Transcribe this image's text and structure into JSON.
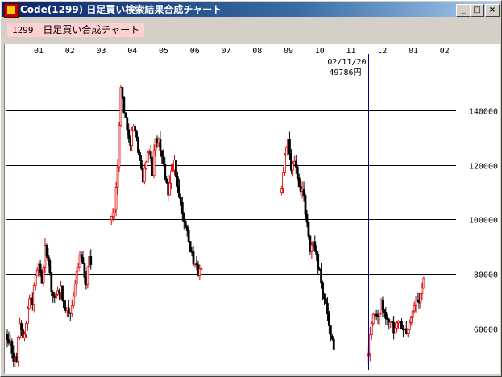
{
  "window": {
    "title": "Code(1299)  日足買い検索結果合成チャート",
    "buttons": {
      "minimize": "_",
      "maximize": "□",
      "close": "×"
    }
  },
  "header": {
    "code": "1299",
    "label": "日足買い合成チャート"
  },
  "cursor": {
    "date": "02/11/20",
    "price": "49786円"
  },
  "colors": {
    "up": "#e00000",
    "down": "#000000",
    "grid": "#000000",
    "cursor": "#000080"
  },
  "chart_data": {
    "type": "candlestick",
    "x_month_labels": [
      "01",
      "02",
      "03",
      "04",
      "05",
      "06",
      "07",
      "08",
      "09",
      "10",
      "11",
      "12",
      "01",
      "02"
    ],
    "y_ticks": [
      60000,
      80000,
      100000,
      120000,
      140000
    ],
    "y_tick_labels": [
      "60000",
      "80000",
      "100000",
      "120000",
      "140000"
    ],
    "ylim": [
      45000,
      160000
    ],
    "cursor_day_index": 229,
    "num_days": 285,
    "segments": [
      {
        "start": 0,
        "anchors": [
          58000,
          55000,
          50000,
          48000,
          62000,
          58000,
          60000,
          72000,
          70000,
          80000,
          82000,
          78000,
          90000,
          85000,
          75000,
          70000,
          72000,
          74000,
          66000,
          68000,
          65000,
          70000,
          80000,
          88000,
          82000,
          78000,
          85000,
          80000
        ]
      },
      {
        "start": 66,
        "anchors": [
          100000,
          105000,
          120000,
          148000,
          140000,
          132000,
          128000,
          135000,
          132000,
          120000,
          115000,
          122000,
          125000,
          118000,
          130000,
          128000,
          122000,
          115000,
          110000,
          118000,
          122000,
          112000,
          108000,
          100000,
          95000,
          88000,
          85000,
          82000,
          80000,
          82000
        ]
      },
      {
        "start": 174,
        "anchors": [
          110000,
          122000,
          130000,
          118000,
          120000,
          115000,
          112000,
          108000,
          98000,
          88000,
          92000,
          86000,
          80000,
          74000,
          68000,
          62000,
          55000,
          50000
        ]
      },
      {
        "start": 229,
        "anchors": [
          50000,
          62000,
          66000,
          64000,
          70000,
          65000,
          64000,
          62000,
          60000,
          64000,
          62000,
          60000,
          58000,
          62000,
          66000,
          72000,
          70000,
          74000,
          80000
        ]
      }
    ]
  }
}
